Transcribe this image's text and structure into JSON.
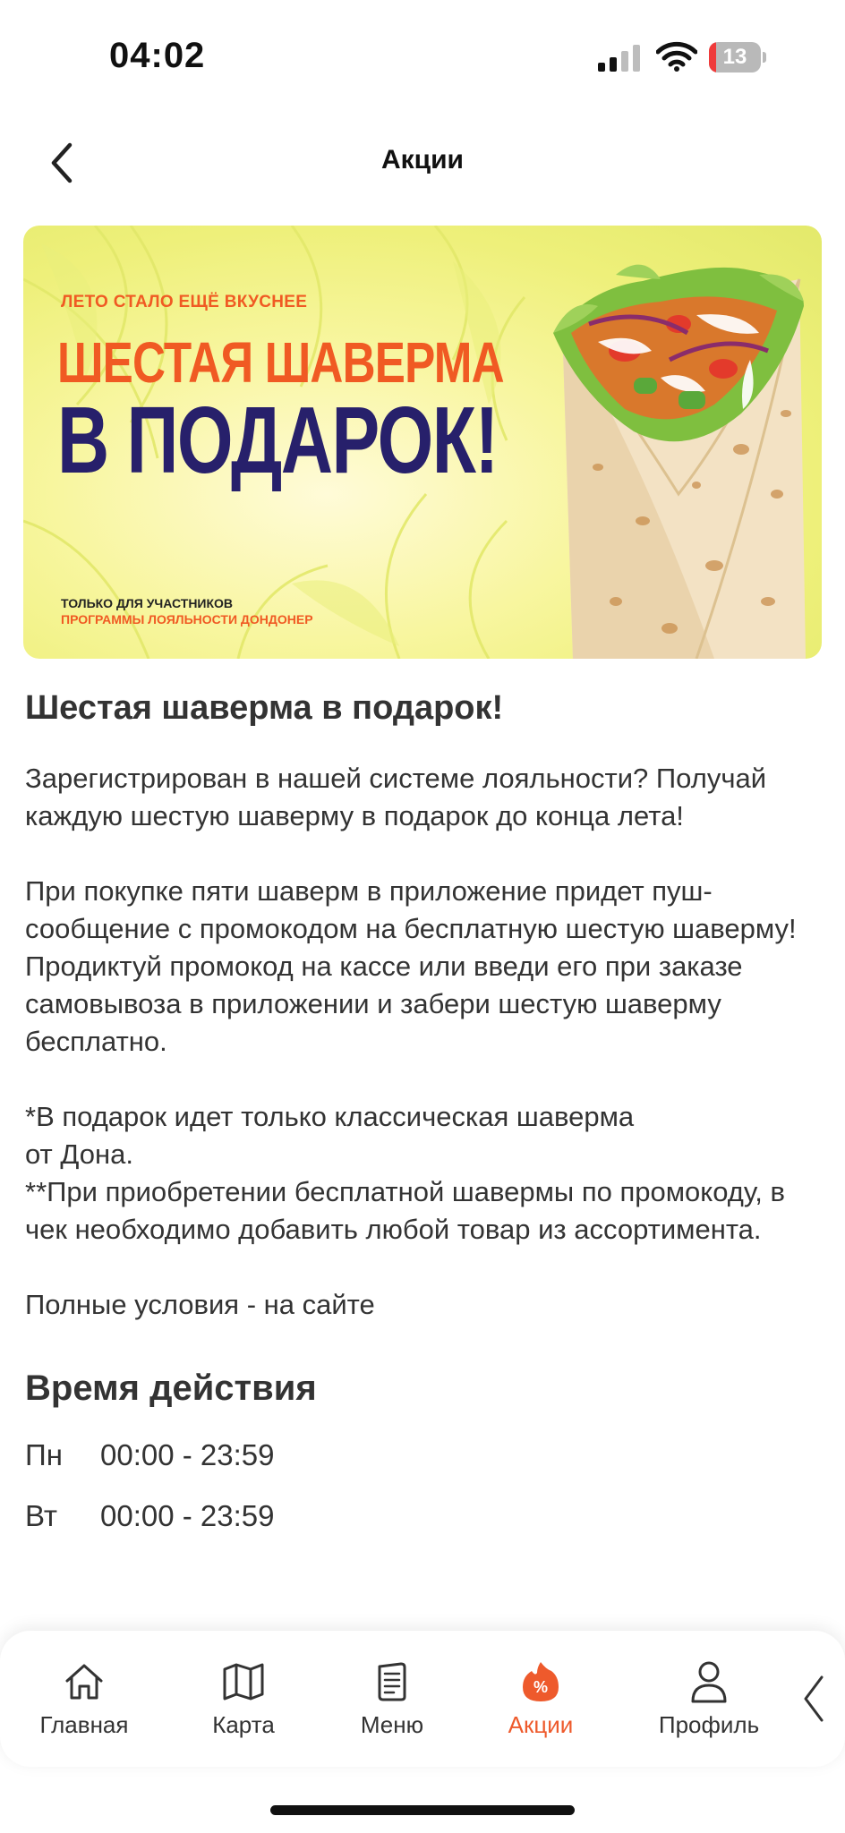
{
  "status_bar": {
    "time": "04:02",
    "battery": "13",
    "battery_level": 0.13
  },
  "header": {
    "title": "Акции",
    "back_icon": "chevron-left-icon"
  },
  "banner": {
    "kicker": "ЛЕТО СТАЛО ЕЩЁ ВКУСНЕЕ",
    "headline_line1": "ШЕСТАЯ ШАВЕРМА",
    "headline_line2": "В ПОДАРОК!",
    "footnote_line1": "ТОЛЬКО ДЛЯ УЧАСТНИКОВ",
    "footnote_line2": "ПРОГРАММЫ ЛОЯЛЬНОСТИ ДОНДОНЕР"
  },
  "promo": {
    "title": "Шестая шаверма в подарок!",
    "paragraph1": "Зарегистрирован в нашей системе лояльности? Получай каждую шестую шаверму в подарок до конца лета!",
    "paragraph2": "При покупке пяти шаверм в приложение придет пуш-сообщение с промокодом на бесплатную шестую шаверму! Продиктуй промокод на кассе или введи его при заказе самовывоза в приложении и забери шестую шаверму бесплатно.",
    "note1_line1": "*В подарок идет только классическая шаверма",
    "note1_line2": "от Дона.",
    "note2": "**При приобретении бесплатной шавермы по промокоду, в чек необходимо добавить любой товар из ассортимента.",
    "terms": "Полные условия - на сайте"
  },
  "schedule": {
    "title": "Время действия",
    "rows": [
      {
        "day": "Пн",
        "time": "00:00 - 23:59"
      },
      {
        "day": "Вт",
        "time": "00:00 - 23:59"
      }
    ]
  },
  "tab_bar": {
    "accent": "#ee5a2c",
    "tabs": [
      {
        "label": "Главная",
        "icon": "home-icon"
      },
      {
        "label": "Карта",
        "icon": "map-icon"
      },
      {
        "label": "Меню",
        "icon": "menu-book-icon"
      },
      {
        "label": "Акции",
        "icon": "promo-percent-icon",
        "active": true
      },
      {
        "label": "Профиль",
        "icon": "profile-icon"
      }
    ],
    "more_icon": "chevron-left-icon"
  }
}
